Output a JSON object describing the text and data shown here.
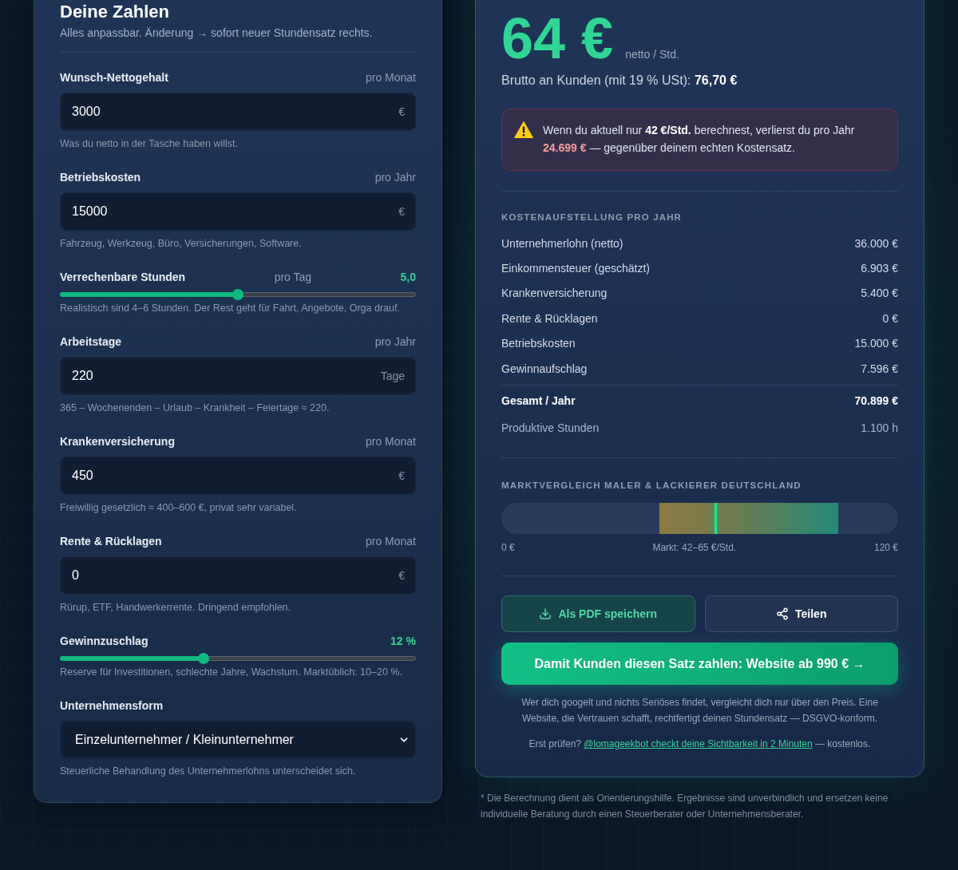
{
  "panel": {
    "title": "Deine Zahlen",
    "subtitle": "Alles anpassbar. Änderung → sofort neuer Stundensatz rechts.",
    "fields": [
      {
        "kind": "input",
        "label": "Wunsch-Nettogehalt",
        "unit": "pro Monat",
        "value": "3000",
        "suffix": "€",
        "hint": "Was du netto in der Tasche haben willst."
      },
      {
        "kind": "input",
        "label": "Betriebskosten",
        "unit": "pro Jahr",
        "value": "15000",
        "suffix": "€",
        "hint": "Fahrzeug, Werkzeug, Büro, Versicherungen, Software."
      },
      {
        "kind": "slider",
        "label": "Verrechenbare Stunden",
        "unit": "pro Tag",
        "value": "5,0",
        "level": 0.5,
        "hint": "Realistisch sind 4–6 Stunden. Der Rest geht für Fahrt, Angebote, Orga drauf."
      },
      {
        "kind": "input",
        "label": "Arbeitstage",
        "unit": "pro Jahr",
        "value": "220",
        "suffix": "Tage",
        "hint": "365 – Wochenenden – Urlaub – Krankheit – Feiertage ≈ 220."
      },
      {
        "kind": "input",
        "label": "Krankenversicherung",
        "unit": "pro Monat",
        "value": "450",
        "suffix": "€",
        "hint": "Freiwillig gesetzlich ≈ 400–600 €, privat sehr variabel."
      },
      {
        "kind": "input",
        "label": "Rente & Rücklagen",
        "unit": "pro Monat",
        "value": "0",
        "suffix": "€",
        "hint": "Rürup, ETF, Handwerkerrente. Dringend empfohlen."
      },
      {
        "kind": "slider",
        "label": "Gewinnzuschlag",
        "value": "12 %",
        "level": 0.4,
        "hint": "Reserve für Investitionen, schlechte Jahre, Wachstum. Marktüblich: 10–20 %."
      },
      {
        "kind": "select",
        "label": "Unternehmensform",
        "value": "Einzelunternehmer / Kleinunternehmer",
        "hint": "Steuerliche Behandlung des Unternehmerlohns unterscheidet sich."
      }
    ]
  },
  "result": {
    "rate": {
      "value": "64 €",
      "unit": "netto / Std."
    },
    "gross": "Brutto an Kunden (mit 19 % USt): **76,70 €**",
    "warning": {
      "parts": [
        {
          "kind": "plain",
          "text": "Wenn du aktuell nur "
        },
        {
          "kind": "bold",
          "text": "42 €/Std."
        },
        {
          "kind": "plain",
          "text": " berechnest, verlierst du pro Jahr "
        },
        {
          "kind": "loss",
          "text": "24.699 €"
        },
        {
          "kind": "plain",
          "text": " — gegenüber deinem echten Kostensatz."
        }
      ]
    },
    "breakdown": {
      "title": "KOSTENAUFSTELLUNG PRO JAHR",
      "rows": [
        {
          "label": "Unternehmerlohn (netto)",
          "value": "36.000 €"
        },
        {
          "label": "Einkommensteuer (geschätzt)",
          "value": "6.903 €"
        },
        {
          "label": "Krankenversicherung",
          "value": "5.400 €"
        },
        {
          "label": "Rente & Rücklagen",
          "value": "0 €"
        },
        {
          "label": "Betriebskosten",
          "value": "15.000 €"
        },
        {
          "label": "Gewinnaufschlag",
          "value": "7.596 €"
        }
      ],
      "total": {
        "label": "Gesamt / Jahr",
        "value": "70.899 €"
      },
      "hours": {
        "label": "Produktive Stunden",
        "value": "1.100 h"
      }
    },
    "market": {
      "title": "MARKTVERGLEICH MALER & LACKIERER DEUTSCHLAND",
      "marker": {
        "level": 0.54
      },
      "min_label": "0 €",
      "range_label": "Markt: 42–65 €/Std.",
      "max_label": "120 €"
    },
    "actions": [
      {
        "kind": "download",
        "label": "Als PDF speichern"
      },
      {
        "kind": "share",
        "label": "Teilen"
      }
    ],
    "cta": {
      "label": "Damit Kunden diesen Satz zahlen: Website ab 990 € →"
    },
    "pitch": "Wer dich googelt und nichts Seriöses findet, vergleicht dich nur über den Preis. Eine Website, die Vertrauen schafft, rechtfertigt deinen Stundensatz — DSGVO-konform.",
    "check": {
      "before": "Erst prüfen?",
      "link": "@lomageekbot checkt deine Sichtbarkeit in 2 Minuten",
      "after": "— kostenlos."
    }
  },
  "footnote": "* Die Berechnung dient als Orientierungshilfe. Ergebnisse sind unverbindlich und ersetzen keine individuelle Beratung durch einen Steuerberater oder Unternehmensberater."
}
